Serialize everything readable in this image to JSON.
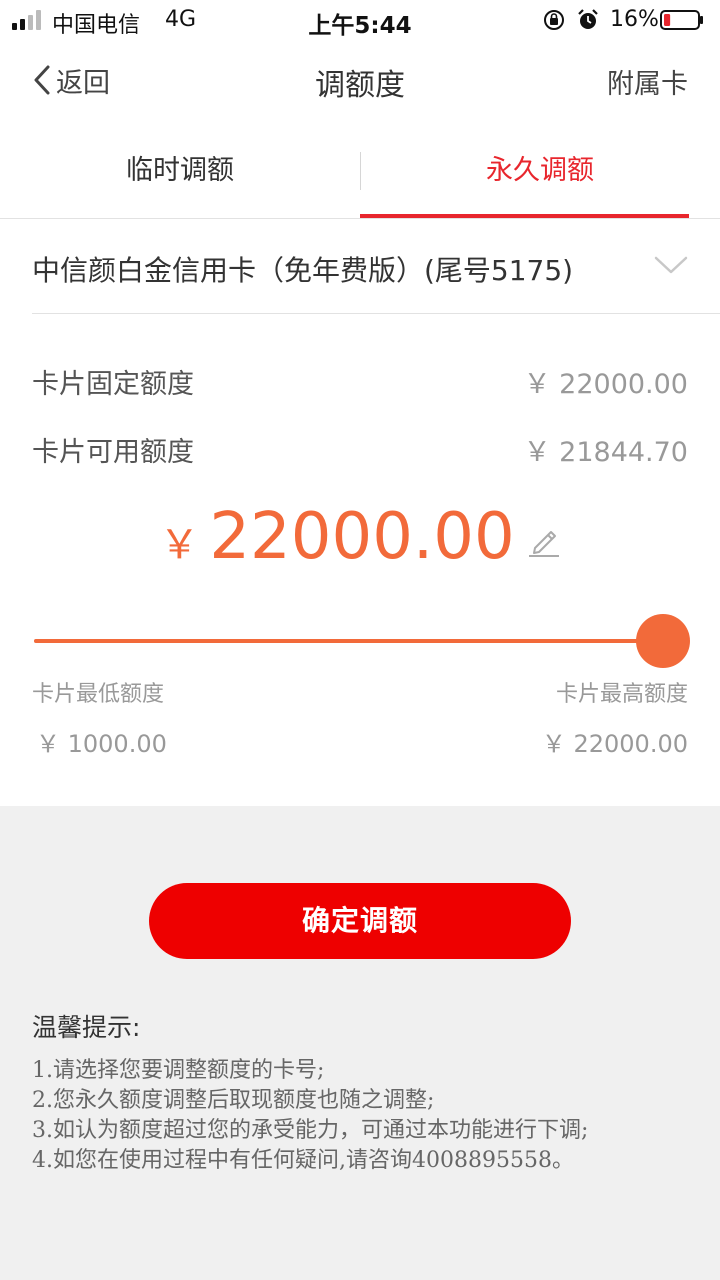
{
  "status_bar": {
    "carrier": "中国电信",
    "network": "4G",
    "time": "上午5:44",
    "battery_percent": "16%",
    "battery_level": 0.16
  },
  "nav": {
    "back_label": "返回",
    "title": "调额度",
    "right_label": "附属卡"
  },
  "tabs": [
    {
      "label": "临时调额",
      "active": false
    },
    {
      "label": "永久调额",
      "active": true
    }
  ],
  "card": {
    "name": "中信颜白金信用卡（免年费版）(尾号5175)"
  },
  "info": {
    "fixed_label": "卡片固定额度",
    "fixed_value": "￥ 22000.00",
    "available_label": "卡片可用额度",
    "available_value": "￥ 21844.70"
  },
  "adjust": {
    "currency": "￥",
    "amount": "22000.00",
    "slider_fraction": 1.0
  },
  "range": {
    "min_label": "卡片最低额度",
    "max_label": "卡片最高额度",
    "min_value": "￥ 1000.00",
    "max_value": "￥ 22000.00"
  },
  "confirm_label": "确定调额",
  "tips": {
    "title": "温馨提示:",
    "items": [
      "1.请选择您要调整额度的卡号;",
      "2.您永久额度调整后取现额度也随之调整;",
      "3.如认为额度超过您的承受能力，可通过本功能进行下调;",
      "4.如您在使用过程中有任何疑问,请咨询4008895558。"
    ]
  },
  "colors": {
    "accent_red": "#e8262d",
    "button_red": "#ee0000",
    "amount_orange": "#f26a3a"
  }
}
